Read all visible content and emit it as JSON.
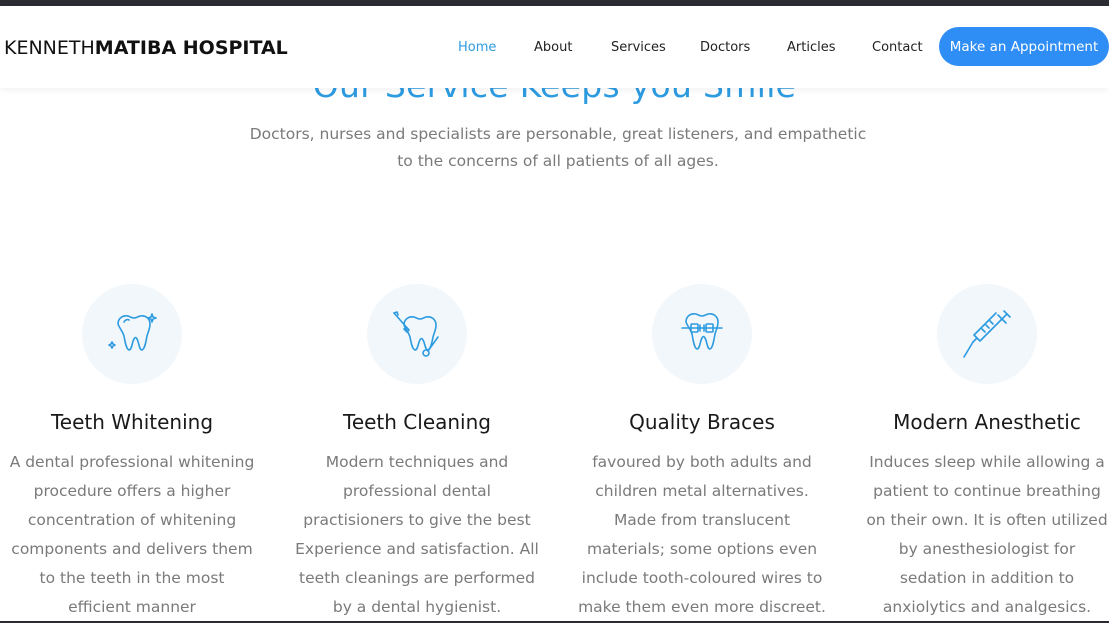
{
  "navbar": {
    "brand_light": "KENNETH",
    "brand_bold": "MATIBA HOSPITAL",
    "links": [
      "Home",
      "About",
      "Services",
      "Doctors",
      "Articles",
      "Contact"
    ],
    "cta_label": "Make an Appointment",
    "active_link": "Home"
  },
  "section": {
    "title": "Our Service Keeps you Smile",
    "subtitle": "Doctors, nurses and specialists are personable, great listeners, and empathetic to the concerns of all patients of all ages."
  },
  "services": [
    {
      "icon": "tooth-sparkle-icon",
      "title": "Teeth Whitening",
      "description": "A dental professional whitening procedure offers a higher concentration of whitening components and delivers them to the teeth in the most efficient manner"
    },
    {
      "icon": "tooth-cleaning-icon",
      "title": "Teeth Cleaning",
      "description": "Modern techniques and professional dental practisioners to give the best Experience and satisfaction. All teeth cleanings are performed by a dental hygienist."
    },
    {
      "icon": "tooth-braces-icon",
      "title": "Quality Braces",
      "description": "favoured by both adults and children metal alternatives. Made from translucent materials; some options even include tooth-coloured wires to make them even more discreet."
    },
    {
      "icon": "syringe-icon",
      "title": "Modern Anesthetic",
      "description": "Induces sleep while allowing a patient to continue breathing on their own. It is often utilized by anesthesiologist for sedation in addition to anxiolytics and analgesics."
    }
  ],
  "colors": {
    "accent": "#2d9be0",
    "cta": "#2f8ef5",
    "icon_bg": "#f2f7fc",
    "body_text": "#7a7a7a"
  }
}
